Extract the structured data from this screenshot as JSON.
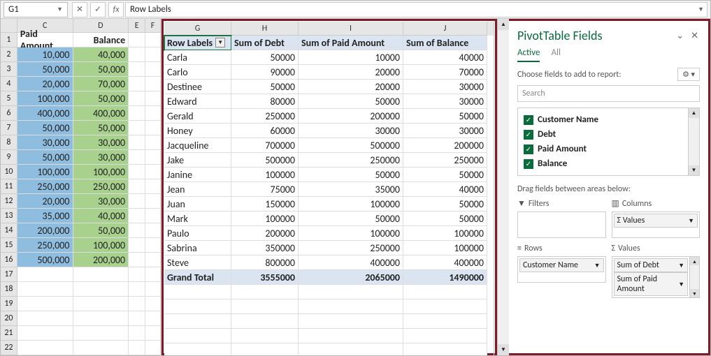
{
  "namebox": "G1",
  "formula": "Row Labels",
  "left": {
    "headers": {
      "c": "Paid Amount",
      "d": "Balance"
    },
    "rows": [
      {
        "r": 2,
        "c": "10,000",
        "d": "40,000"
      },
      {
        "r": 3,
        "c": "50,000",
        "d": "50,000"
      },
      {
        "r": 4,
        "c": "20,000",
        "d": "70,000"
      },
      {
        "r": 5,
        "c": "100,000",
        "d": "50,000"
      },
      {
        "r": 6,
        "c": "400,000",
        "d": "400,000"
      },
      {
        "r": 7,
        "c": "50,000",
        "d": "50,000"
      },
      {
        "r": 8,
        "c": "30,000",
        "d": "30,000"
      },
      {
        "r": 9,
        "c": "50,000",
        "d": "30,000"
      },
      {
        "r": 10,
        "c": "100,000",
        "d": "100,000"
      },
      {
        "r": 11,
        "c": "250,000",
        "d": "250,000"
      },
      {
        "r": 12,
        "c": "20,000",
        "d": "30,000"
      },
      {
        "r": 13,
        "c": "35,000",
        "d": "40,000"
      },
      {
        "r": 14,
        "c": "200,000",
        "d": "50,000"
      },
      {
        "r": 15,
        "c": "250,000",
        "d": "100,000"
      },
      {
        "r": 16,
        "c": "500,000",
        "d": "200,000"
      }
    ],
    "empty": [
      17,
      18,
      19,
      20,
      21,
      22
    ]
  },
  "pivot": {
    "headers": {
      "g": "Row Labels",
      "h": "Sum of Debt",
      "i": "Sum of Paid Amount",
      "j": "Sum of Balance"
    },
    "rows": [
      {
        "g": "Carla",
        "h": "50000",
        "i": "10000",
        "j": "40000"
      },
      {
        "g": "Carlo",
        "h": "90000",
        "i": "20000",
        "j": "70000"
      },
      {
        "g": "Destinee",
        "h": "50000",
        "i": "20000",
        "j": "30000"
      },
      {
        "g": "Edward",
        "h": "80000",
        "i": "50000",
        "j": "30000"
      },
      {
        "g": "Gerald",
        "h": "250000",
        "i": "200000",
        "j": "50000"
      },
      {
        "g": "Honey",
        "h": "60000",
        "i": "30000",
        "j": "30000"
      },
      {
        "g": "Jacqueline",
        "h": "700000",
        "i": "500000",
        "j": "200000"
      },
      {
        "g": "Jake",
        "h": "500000",
        "i": "250000",
        "j": "250000"
      },
      {
        "g": "Janine",
        "h": "100000",
        "i": "50000",
        "j": "50000"
      },
      {
        "g": "Jean",
        "h": "75000",
        "i": "35000",
        "j": "40000"
      },
      {
        "g": "Juan",
        "h": "150000",
        "i": "100000",
        "j": "50000"
      },
      {
        "g": "Mark",
        "h": "100000",
        "i": "50000",
        "j": "50000"
      },
      {
        "g": "Paulo",
        "h": "200000",
        "i": "100000",
        "j": "100000"
      },
      {
        "g": "Sabrina",
        "h": "350000",
        "i": "250000",
        "j": "100000"
      },
      {
        "g": "Steve",
        "h": "800000",
        "i": "400000",
        "j": "400000"
      }
    ],
    "total": {
      "g": "Grand Total",
      "h": "3555000",
      "i": "2065000",
      "j": "1490000"
    }
  },
  "pane": {
    "title": "PivotTable Fields",
    "tabs": {
      "active": "Active",
      "all": "All"
    },
    "choose": "Choose fields to add to report:",
    "search": "Search",
    "fields": [
      "Customer Name",
      "Debt",
      "Paid Amount",
      "Balance"
    ],
    "drag": "Drag fields between areas below:",
    "filters": "Filters",
    "columns": "Columns",
    "rowsLbl": "Rows",
    "valuesLbl": "Values",
    "colpill": "Values",
    "rowpill": "Customer Name",
    "valpills": [
      "Sum of Debt",
      "Sum of Paid Amount"
    ]
  }
}
